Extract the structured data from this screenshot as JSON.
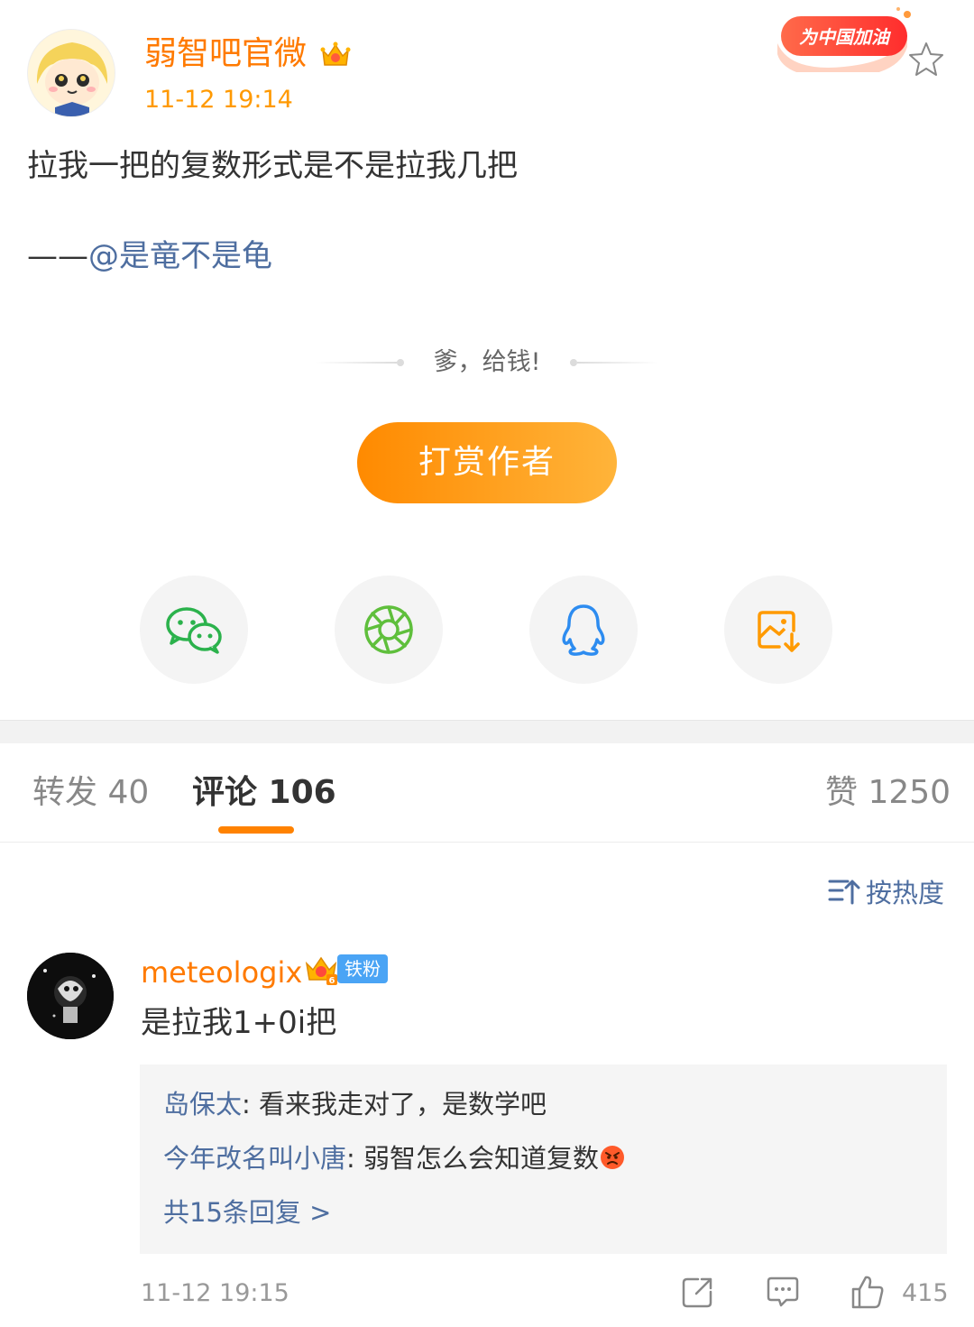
{
  "post": {
    "author": "弱智吧官微",
    "time": "11-12 19:14",
    "badge_text": "为中国加油",
    "text": "拉我一把的复数形式是不是拉我几把",
    "credit_dash": "——",
    "credit_mention": "@是竜不是龟"
  },
  "reward": {
    "prompt": "爹，给钱!",
    "button_label": "打赏作者"
  },
  "share_icons": [
    "wechat-icon",
    "moments-icon",
    "qq-icon",
    "save-image-icon"
  ],
  "tabs": {
    "repost": "转发 40",
    "comment": "评论 106",
    "like": "赞 1250"
  },
  "sort": {
    "label": "按热度"
  },
  "comment": {
    "user": "meteologix",
    "fan_badge": "铁粉",
    "level": "6",
    "text": "是拉我1+0i把",
    "time": "11-12 19:15",
    "likes": "415",
    "replies": [
      {
        "name": "岛保太",
        "text": ": 看来我走对了，是数学吧"
      },
      {
        "name": "今年改名叫小唐",
        "text": ": 弱智怎么会知道复数"
      }
    ],
    "more_replies": "共15条回复 >"
  },
  "colors": {
    "accent": "#ff8200",
    "username": "#ff7a00",
    "link": "#4e6ea0"
  }
}
